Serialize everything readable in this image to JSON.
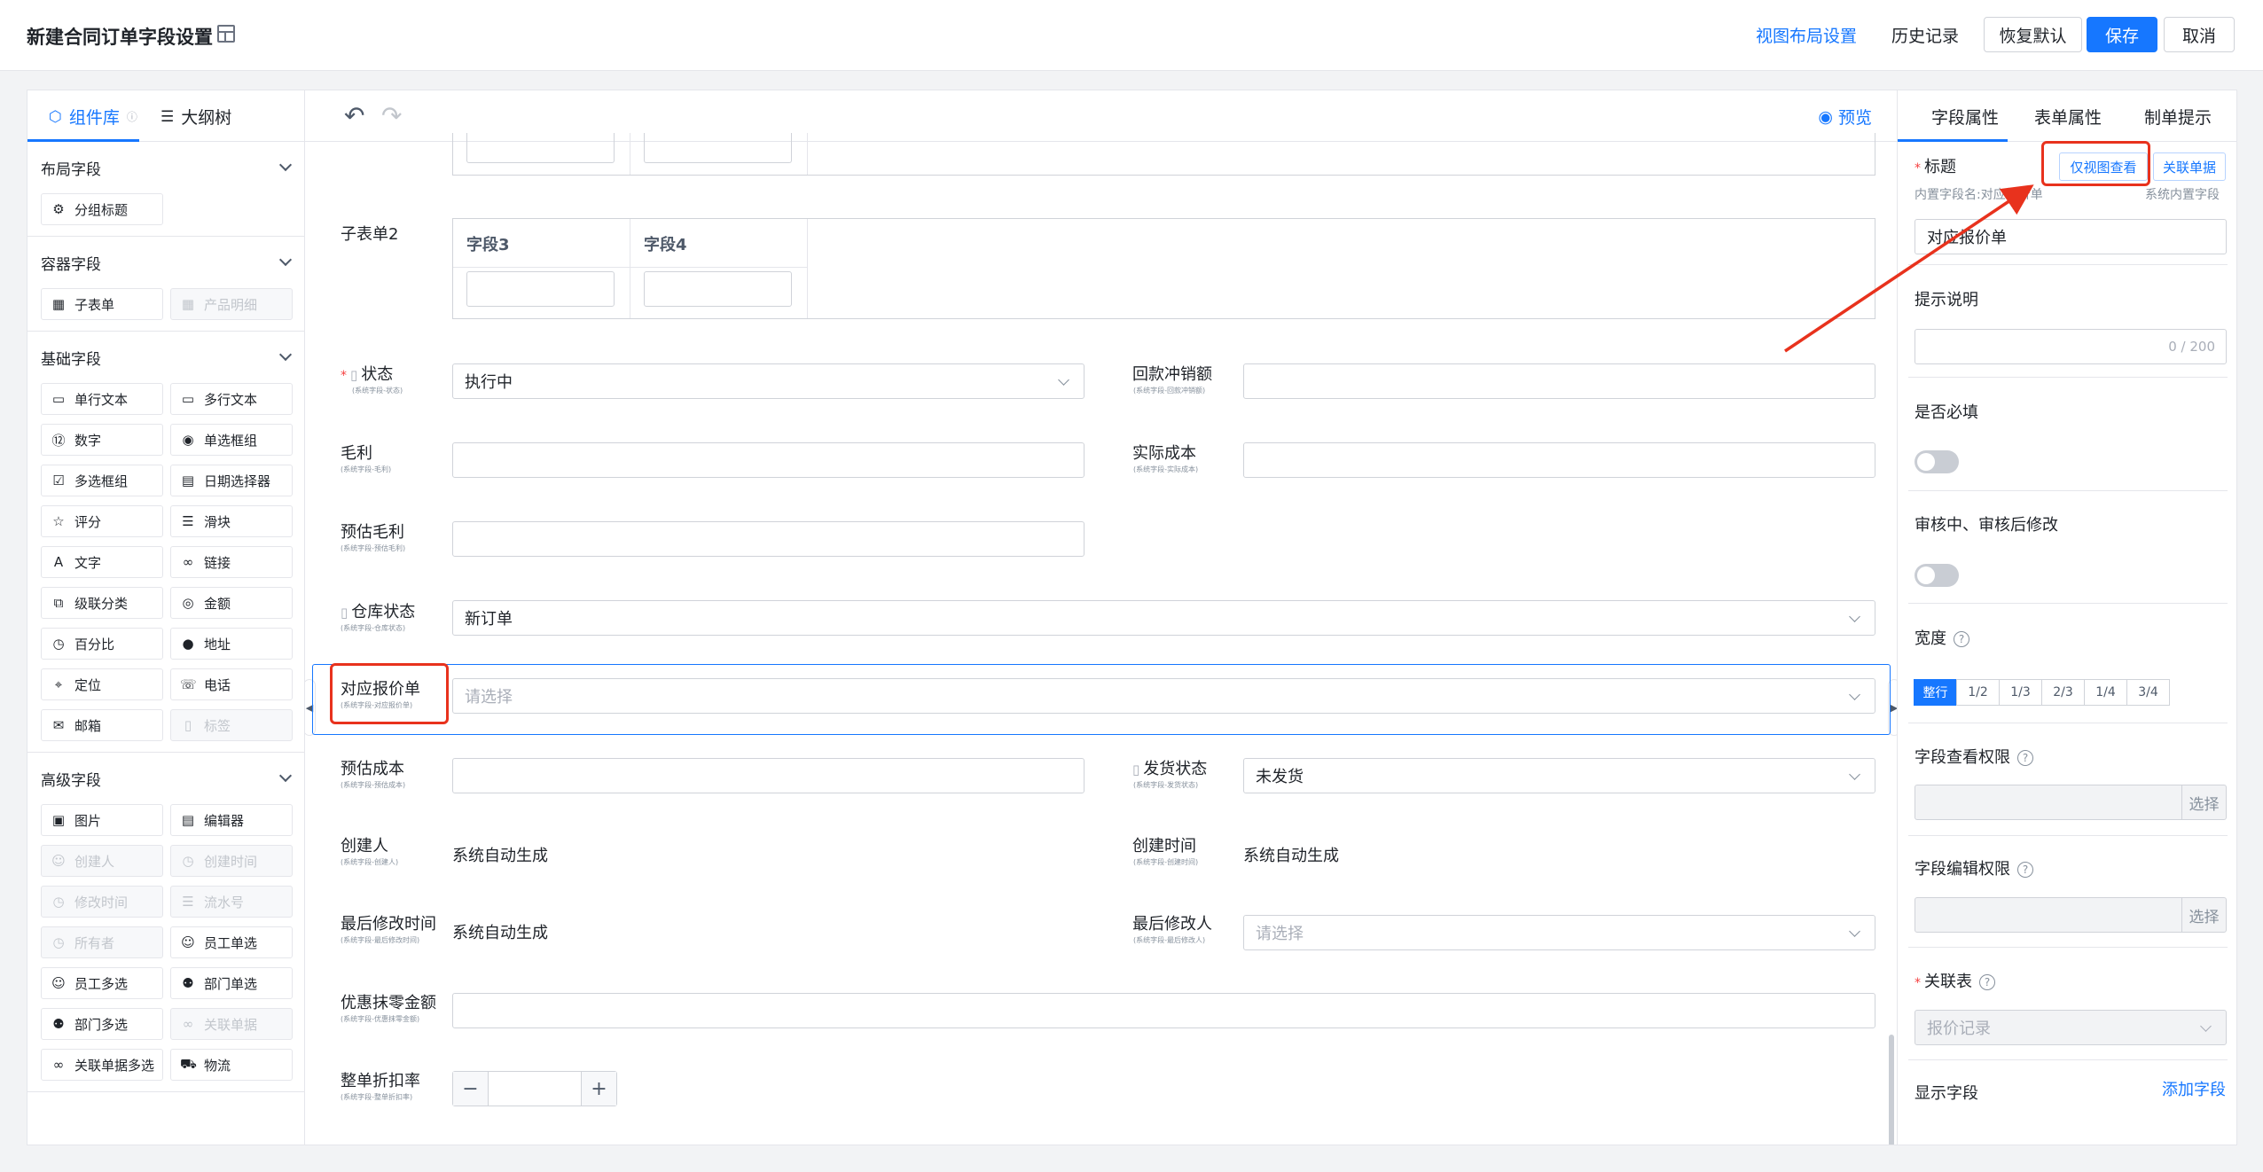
{
  "header": {
    "title": "新建合同订单字段设置",
    "view_layout": "视图布局设置",
    "history": "历史记录",
    "restore_default": "恢复默认",
    "save": "保存",
    "cancel": "取消"
  },
  "left_panel": {
    "tabs": [
      "组件库",
      "大纲树"
    ],
    "sections": [
      {
        "title": "布局字段",
        "items": [
          {
            "label": "分组标题",
            "icon": "puzzle-icon",
            "glyph": "⚙",
            "disabled": false
          }
        ]
      },
      {
        "title": "容器字段",
        "items": [
          {
            "label": "子表单",
            "icon": "table-icon",
            "glyph": "▦",
            "disabled": false
          },
          {
            "label": "产品明细",
            "icon": "table-icon",
            "glyph": "▦",
            "disabled": true
          }
        ]
      },
      {
        "title": "基础字段",
        "items": [
          {
            "label": "单行文本",
            "icon": "input-icon",
            "glyph": "▭",
            "disabled": false
          },
          {
            "label": "多行文本",
            "icon": "textarea-icon",
            "glyph": "▭",
            "disabled": false
          },
          {
            "label": "数字",
            "icon": "number-icon",
            "glyph": "⑫",
            "disabled": false
          },
          {
            "label": "单选框组",
            "icon": "radio-icon",
            "glyph": "◉",
            "disabled": false
          },
          {
            "label": "多选框组",
            "icon": "checkbox-icon",
            "glyph": "☑",
            "disabled": false
          },
          {
            "label": "日期选择器",
            "icon": "calendar-icon",
            "glyph": "▤",
            "disabled": false
          },
          {
            "label": "评分",
            "icon": "star-icon",
            "glyph": "☆",
            "disabled": false
          },
          {
            "label": "滑块",
            "icon": "slider-icon",
            "glyph": "☰",
            "disabled": false
          },
          {
            "label": "文字",
            "icon": "text-icon",
            "glyph": "A",
            "disabled": false
          },
          {
            "label": "链接",
            "icon": "link-icon",
            "glyph": "∞",
            "disabled": false
          },
          {
            "label": "级联分类",
            "icon": "cascade-icon",
            "glyph": "⧉",
            "disabled": false
          },
          {
            "label": "金额",
            "icon": "money-icon",
            "glyph": "◎",
            "disabled": false
          },
          {
            "label": "百分比",
            "icon": "percent-icon",
            "glyph": "◷",
            "disabled": false
          },
          {
            "label": "地址",
            "icon": "location-icon",
            "glyph": "●",
            "disabled": false
          },
          {
            "label": "定位",
            "icon": "locate-icon",
            "glyph": "⌖",
            "disabled": false
          },
          {
            "label": "电话",
            "icon": "phone-icon",
            "glyph": "☏",
            "disabled": false
          },
          {
            "label": "邮箱",
            "icon": "mail-icon",
            "glyph": "✉",
            "disabled": false
          },
          {
            "label": "标签",
            "icon": "tag-icon",
            "glyph": "▯",
            "disabled": true
          }
        ]
      },
      {
        "title": "高级字段",
        "items": [
          {
            "label": "图片",
            "icon": "image-icon",
            "glyph": "▣",
            "disabled": false
          },
          {
            "label": "编辑器",
            "icon": "editor-icon",
            "glyph": "▤",
            "disabled": false
          },
          {
            "label": "创建人",
            "icon": "user-icon",
            "glyph": "☺",
            "disabled": true
          },
          {
            "label": "创建时间",
            "icon": "clock-icon",
            "glyph": "◷",
            "disabled": true
          },
          {
            "label": "修改时间",
            "icon": "clock-icon",
            "glyph": "◷",
            "disabled": true
          },
          {
            "label": "流水号",
            "icon": "list-icon",
            "glyph": "☰",
            "disabled": true
          },
          {
            "label": "所有者",
            "icon": "owner-icon",
            "glyph": "◷",
            "disabled": true
          },
          {
            "label": "员工单选",
            "icon": "user-icon",
            "glyph": "☺",
            "disabled": false
          },
          {
            "label": "员工多选",
            "icon": "users-icon",
            "glyph": "☺",
            "disabled": false
          },
          {
            "label": "部门单选",
            "icon": "dept-icon",
            "glyph": "⚉",
            "disabled": false
          },
          {
            "label": "部门多选",
            "icon": "dept-icon",
            "glyph": "⚉",
            "disabled": false
          },
          {
            "label": "关联单据",
            "icon": "link-icon",
            "glyph": "∞",
            "disabled": true
          },
          {
            "label": "关联单据多选",
            "icon": "link-icon",
            "glyph": "∞",
            "disabled": false
          },
          {
            "label": "物流",
            "icon": "truck-icon",
            "glyph": "⛟",
            "disabled": false
          }
        ]
      }
    ]
  },
  "canvas": {
    "preview": "预览",
    "subtable2_label": "子表单2",
    "subtable2_cols": [
      "字段3",
      "字段4"
    ],
    "fields": {
      "status": {
        "label": "状态",
        "sub": "(系统字段-状态)",
        "value": "执行中"
      },
      "refund": {
        "label": "回款冲销额",
        "sub": "(系统字段-回款冲销额)",
        "value": ""
      },
      "gross_profit": {
        "label": "毛利",
        "sub": "(系统字段-毛利)",
        "value": ""
      },
      "actual_cost": {
        "label": "实际成本",
        "sub": "(系统字段-实际成本)",
        "value": ""
      },
      "est_profit": {
        "label": "预估毛利",
        "sub": "(系统字段-预估毛利)",
        "value": ""
      },
      "warehouse": {
        "label": "仓库状态",
        "sub": "(系统字段-仓库状态)",
        "value": "新订单"
      },
      "quote": {
        "label": "对应报价单",
        "sub": "(系统字段-对应报价单)",
        "placeholder": "请选择"
      },
      "est_cost": {
        "label": "预估成本",
        "sub": "(系统字段-预估成本)",
        "value": ""
      },
      "ship_status": {
        "label": "发货状态",
        "sub": "(系统字段-发货状态)",
        "value": "未发货"
      },
      "creator": {
        "label": "创建人",
        "sub": "(系统字段-创建人)",
        "value": "系统自动生成"
      },
      "created_at": {
        "label": "创建时间",
        "sub": "(系统字段-创建时间)",
        "value": "系统自动生成"
      },
      "modified_at": {
        "label": "最后修改时间",
        "sub": "(系统字段-最后修改时间)",
        "value": "系统自动生成"
      },
      "modifier": {
        "label": "最后修改人",
        "sub": "(系统字段-最后修改人)",
        "placeholder": "请选择"
      },
      "discount_amount": {
        "label": "优惠抹零金额",
        "sub": "(系统字段-优惠抹零金额)",
        "value": ""
      },
      "discount_rate": {
        "label": "整单折扣率",
        "sub": "(系统字段-整单折扣率)",
        "value": ""
      }
    }
  },
  "right_panel": {
    "tabs": [
      "字段属性",
      "表单属性",
      "制单提示"
    ],
    "title_label": "标题",
    "view_only_btn": "仅视图查看",
    "related_doc_btn": "关联单据",
    "internal_name": "内置字段名:对应报价单",
    "system_field": "系统内置字段",
    "title_value": "对应报价单",
    "hint_label": "提示说明",
    "hint_counter": "0 / 200",
    "required_label": "是否必填",
    "edit_in_review_label": "审核中、审核后修改",
    "width_label": "宽度",
    "width_options": [
      "整行",
      "1/2",
      "1/3",
      "2/3",
      "1/4",
      "3/4"
    ],
    "view_perm_label": "字段查看权限",
    "edit_perm_label": "字段编辑权限",
    "choose": "选择",
    "relation_label": "关联表",
    "relation_value": "报价记录",
    "display_fields_label": "显示字段",
    "add_field": "添加字段"
  },
  "colors": {
    "accent": "#1677ff",
    "highlight_red": "#e8321d"
  }
}
